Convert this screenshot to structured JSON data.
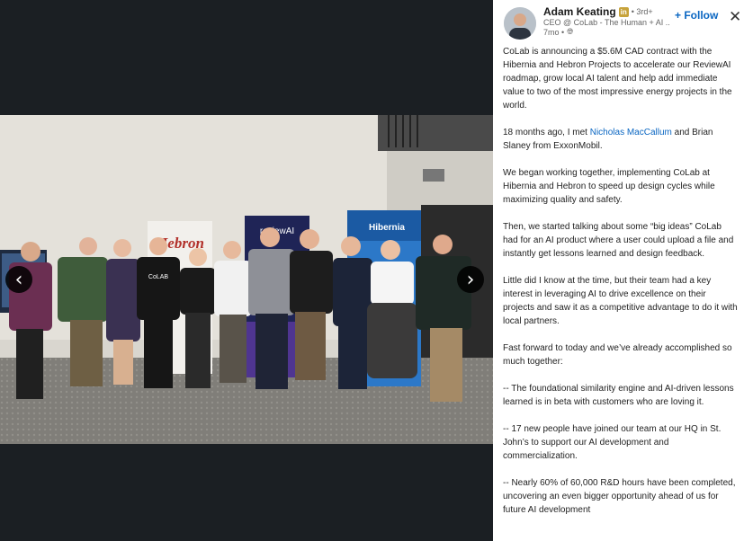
{
  "post": {
    "author_name": "Adam Keating",
    "badge": "in",
    "degree": "• 3rd+",
    "headline": "CEO @ CoLab - The Human + AI ...",
    "time": "7mo •",
    "globe_icon": "globe-icon",
    "follow_label": "+ Follow",
    "close_icon": "close-icon"
  },
  "viewer": {
    "prev_icon": "chevron-left-icon",
    "next_icon": "chevron-right-icon",
    "prev_glyph": "‹",
    "next_glyph": "›",
    "banners": {
      "left": "Hebron",
      "middle": "reviewAI",
      "right": "Hibernia"
    },
    "shirt_logo": "CoLAB"
  },
  "body": {
    "p1": "CoLab is announcing a $5.6M CAD contract with the Hibernia and Hebron Projects to accelerate our ReviewAI roadmap, grow local AI talent and help add immediate value to two of the most impressive energy projects in the world.",
    "p2_before": "18 months ago, I met ",
    "p2_mention": "Nicholas MacCallum",
    "p2_after": " and Brian Slaney from ExxonMobil.",
    "p3": "We began working together, implementing CoLab at Hibernia and Hebron to speed up design cycles while maximizing quality and safety.",
    "p4": "Then, we started talking about some “big ideas” CoLab had for an AI product where a user could upload a file and instantly get lessons learned and design feedback.",
    "p5": "Little did I know at the time, but their team had a key interest in leveraging AI to drive excellence on their projects and saw it as a competitive advantage to do it with local partners.",
    "p6": "Fast forward to today and we’ve already accomplished so much together:",
    "p7": "-- The foundational similarity engine and AI-driven lessons learned is in beta with customers who are loving it.",
    "p8": "-- 17 new people have joined our team at our HQ in St. John’s to support our AI development and commercialization.",
    "p9": "-- Nearly 60% of 60,000 R&D hours have been completed, uncovering an even bigger opportunity ahead of us for future AI development"
  },
  "colors": {
    "link": "#0a66c2",
    "viewer_bg": "#1b1f23",
    "badge": "#c7a33b"
  }
}
